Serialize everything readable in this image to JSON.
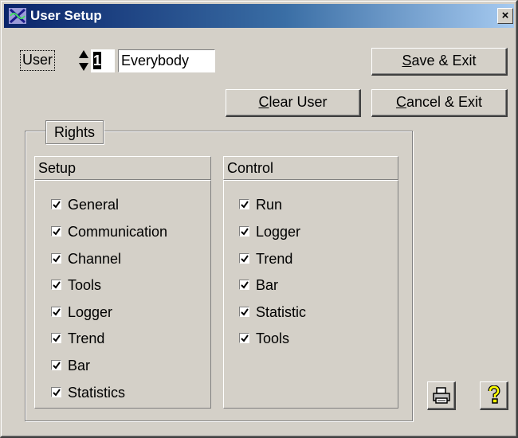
{
  "window": {
    "title": "User Setup",
    "close_glyph": "×",
    "icon": "app-logo-icon"
  },
  "user": {
    "label": "User",
    "number": "1",
    "name": "Everybody"
  },
  "buttons": {
    "save_exit": {
      "mnemonic": "S",
      "rest": "ave & Exit"
    },
    "clear_user": {
      "mnemonic": "C",
      "rest": "lear User"
    },
    "cancel_exit": {
      "mnemonic": "C",
      "rest": "ancel & Exit"
    }
  },
  "rights": {
    "title": "Rights",
    "setup": {
      "title": "Setup",
      "items": [
        {
          "label": "General",
          "checked": true
        },
        {
          "label": "Communication",
          "checked": true
        },
        {
          "label": "Channel",
          "checked": true
        },
        {
          "label": "Tools",
          "checked": true
        },
        {
          "label": "Logger",
          "checked": true
        },
        {
          "label": "Trend",
          "checked": true
        },
        {
          "label": "Bar",
          "checked": true
        },
        {
          "label": "Statistics",
          "checked": true
        }
      ]
    },
    "control": {
      "title": "Control",
      "items": [
        {
          "label": "Run",
          "checked": true
        },
        {
          "label": "Logger",
          "checked": true
        },
        {
          "label": "Trend",
          "checked": true
        },
        {
          "label": "Bar",
          "checked": true
        },
        {
          "label": "Statistic",
          "checked": true
        },
        {
          "label": "Tools",
          "checked": true
        }
      ]
    }
  },
  "icons": {
    "print": "printer-icon",
    "help": "help-icon"
  },
  "colors": {
    "face": "#d4d0c8",
    "title_start": "#0a246a",
    "title_end": "#a6caf0",
    "help_yellow": "#ffff00"
  }
}
